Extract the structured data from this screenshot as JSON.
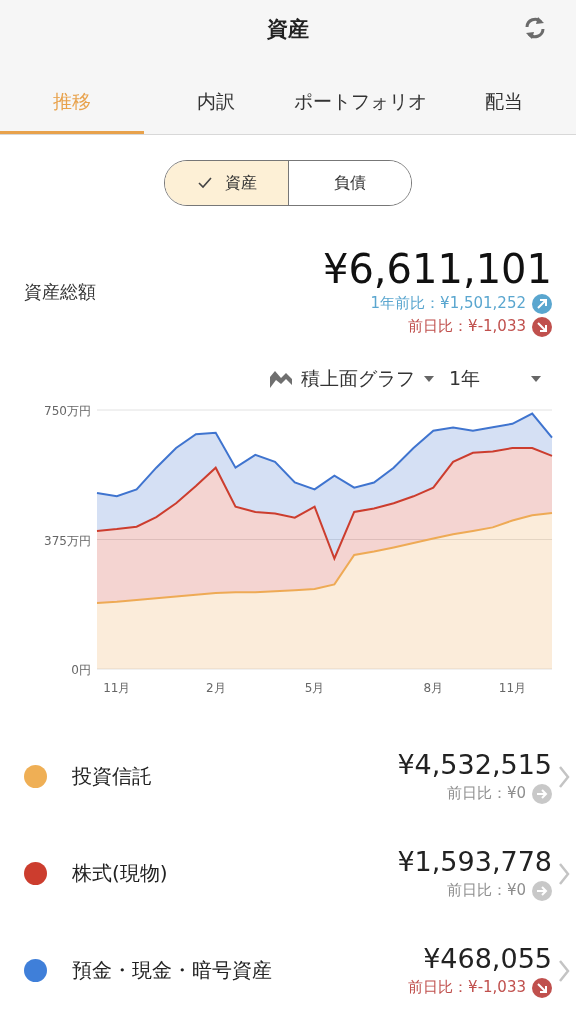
{
  "header": {
    "title": "資産"
  },
  "tabs": [
    {
      "label": "推移",
      "selected": true
    },
    {
      "label": "内訳",
      "selected": false
    },
    {
      "label": "ポートフォリオ",
      "selected": false
    },
    {
      "label": "配当",
      "selected": false
    }
  ],
  "segments": [
    {
      "label": "資産",
      "selected": true
    },
    {
      "label": "負債",
      "selected": false
    }
  ],
  "total": {
    "label": "資産総額",
    "amount": "¥6,611,101",
    "changes": [
      {
        "text": "1年前比：¥1,501,252",
        "kind": "up"
      },
      {
        "text": "前日比：¥-1,033",
        "kind": "down"
      }
    ]
  },
  "chart_controls": {
    "chart_type": "積上面グラフ",
    "period": "1年"
  },
  "chart": {
    "chart_data": {
      "type": "area",
      "stacked": true,
      "categories": [
        null,
        "11月",
        null,
        null,
        null,
        null,
        "2月",
        null,
        null,
        null,
        null,
        "5月",
        null,
        null,
        null,
        null,
        null,
        "8月",
        null,
        null,
        null,
        "11月",
        null,
        null
      ],
      "ylim": [
        0,
        750
      ],
      "yticks": [
        {
          "value": 0,
          "label": "0円"
        },
        {
          "value": 375,
          "label": "375万円"
        },
        {
          "value": 750,
          "label": "750万円"
        }
      ],
      "series": [
        {
          "color": "#eeaa55",
          "values": [
            191,
            195,
            200,
            205,
            210,
            215,
            220,
            222,
            222,
            225,
            228,
            232,
            245,
            330,
            340,
            352,
            365,
            378,
            390,
            400,
            410,
            430,
            445,
            452
          ]
        },
        {
          "color": "#cc3d2e",
          "values": [
            209,
            210,
            212,
            235,
            270,
            315,
            363,
            248,
            233,
            225,
            210,
            238,
            75,
            125,
            125,
            128,
            135,
            147,
            210,
            226,
            220,
            210,
            195,
            165
          ]
        },
        {
          "color": "#3f74cf",
          "values": [
            110,
            95,
            108,
            143,
            160,
            150,
            101,
            113,
            165,
            150,
            102,
            50,
            240,
            70,
            75,
            103,
            140,
            165,
            99,
            64,
            70,
            70,
            100,
            53
          ]
        }
      ]
    }
  },
  "items": [
    {
      "name": "投資信託",
      "color": "#efaf55",
      "amount": "¥4,532,515",
      "change": "前日比：¥0",
      "kind": "flat"
    },
    {
      "name": "株式(現物)",
      "color": "#cc3d2e",
      "amount": "¥1,593,778",
      "change": "前日比：¥0",
      "kind": "flat"
    },
    {
      "name": "預金・現金・暗号資産",
      "color": "#3f7fd9",
      "amount": "¥468,055",
      "change": "前日比：¥-1,033",
      "kind": "down"
    }
  ]
}
